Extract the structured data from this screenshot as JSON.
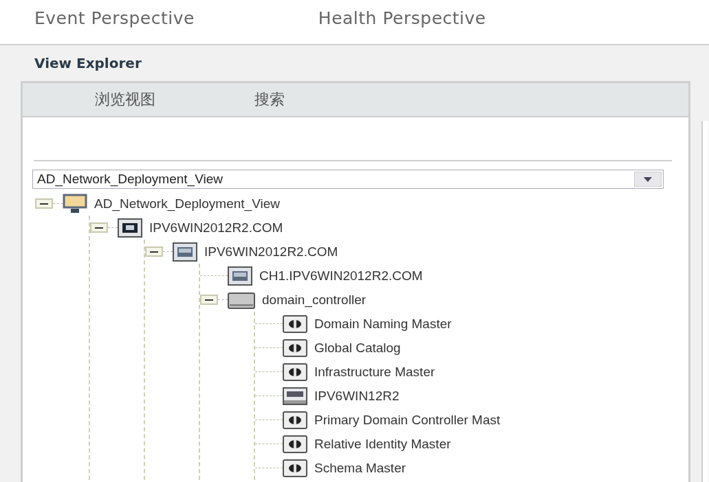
{
  "perspectives": [
    {
      "label": "Event Perspective"
    },
    {
      "label": "Health Perspective"
    }
  ],
  "panel": {
    "title": "View Explorer"
  },
  "tabs": [
    {
      "label": "浏览视图"
    },
    {
      "label": "搜索"
    }
  ],
  "view_select": {
    "value": "AD_Network_Deployment_View"
  },
  "tree": [
    {
      "label": "AD_Network_Deployment_View",
      "kind": "view",
      "expanded": true,
      "children": [
        {
          "label": "IPV6WIN2012R2.COM",
          "kind": "domain",
          "expanded": true,
          "children": [
            {
              "label": "IPV6WIN2012R2.COM",
              "kind": "site",
              "expanded": true,
              "children": [
                {
                  "label": "CH1.IPV6WIN2012R2.COM",
                  "kind": "site"
                },
                {
                  "label": "domain_controller",
                  "kind": "group",
                  "expanded": true,
                  "children": [
                    {
                      "label": "Domain Naming Master",
                      "kind": "role"
                    },
                    {
                      "label": "Global Catalog",
                      "kind": "role"
                    },
                    {
                      "label": "Infrastructure Master",
                      "kind": "role"
                    },
                    {
                      "label": "IPV6WIN12R2",
                      "kind": "computer"
                    },
                    {
                      "label": "Primary Domain Controller Mast",
                      "kind": "role"
                    },
                    {
                      "label": "Relative Identity Master",
                      "kind": "role"
                    },
                    {
                      "label": "Schema Master",
                      "kind": "role"
                    }
                  ]
                }
              ]
            }
          ]
        }
      ]
    }
  ]
}
